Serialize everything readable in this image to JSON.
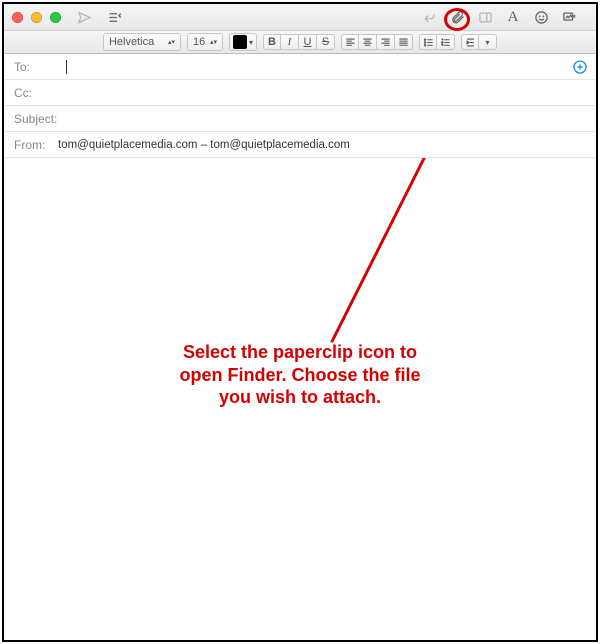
{
  "titlebar": {
    "traffic": {
      "close": "#ff5f57",
      "minimize": "#febc2e",
      "zoom": "#28c840"
    },
    "left_icons": [
      "send-icon",
      "header-options-icon"
    ],
    "right_icons": [
      "reply-icon",
      "attach-icon",
      "sidebar-icon",
      "format-icon",
      "emoji-icon",
      "media-icon"
    ],
    "reply_label": "↩",
    "format_label": "A"
  },
  "format_bar": {
    "font": "Helvetica",
    "size": "16",
    "style_b": "B",
    "style_i": "I",
    "style_u": "U",
    "style_s": "S"
  },
  "fields": {
    "to_label": "To:",
    "cc_label": "Cc:",
    "subject_label": "Subject:",
    "from_label": "From:",
    "from_value": "tom@quietplacemedia.com – tom@quietplacemedia.com"
  },
  "annotation": {
    "text_line1": "Select the paperclip icon to",
    "text_line2": "open Finder. Choose the file",
    "text_line3": "you wish to attach."
  }
}
